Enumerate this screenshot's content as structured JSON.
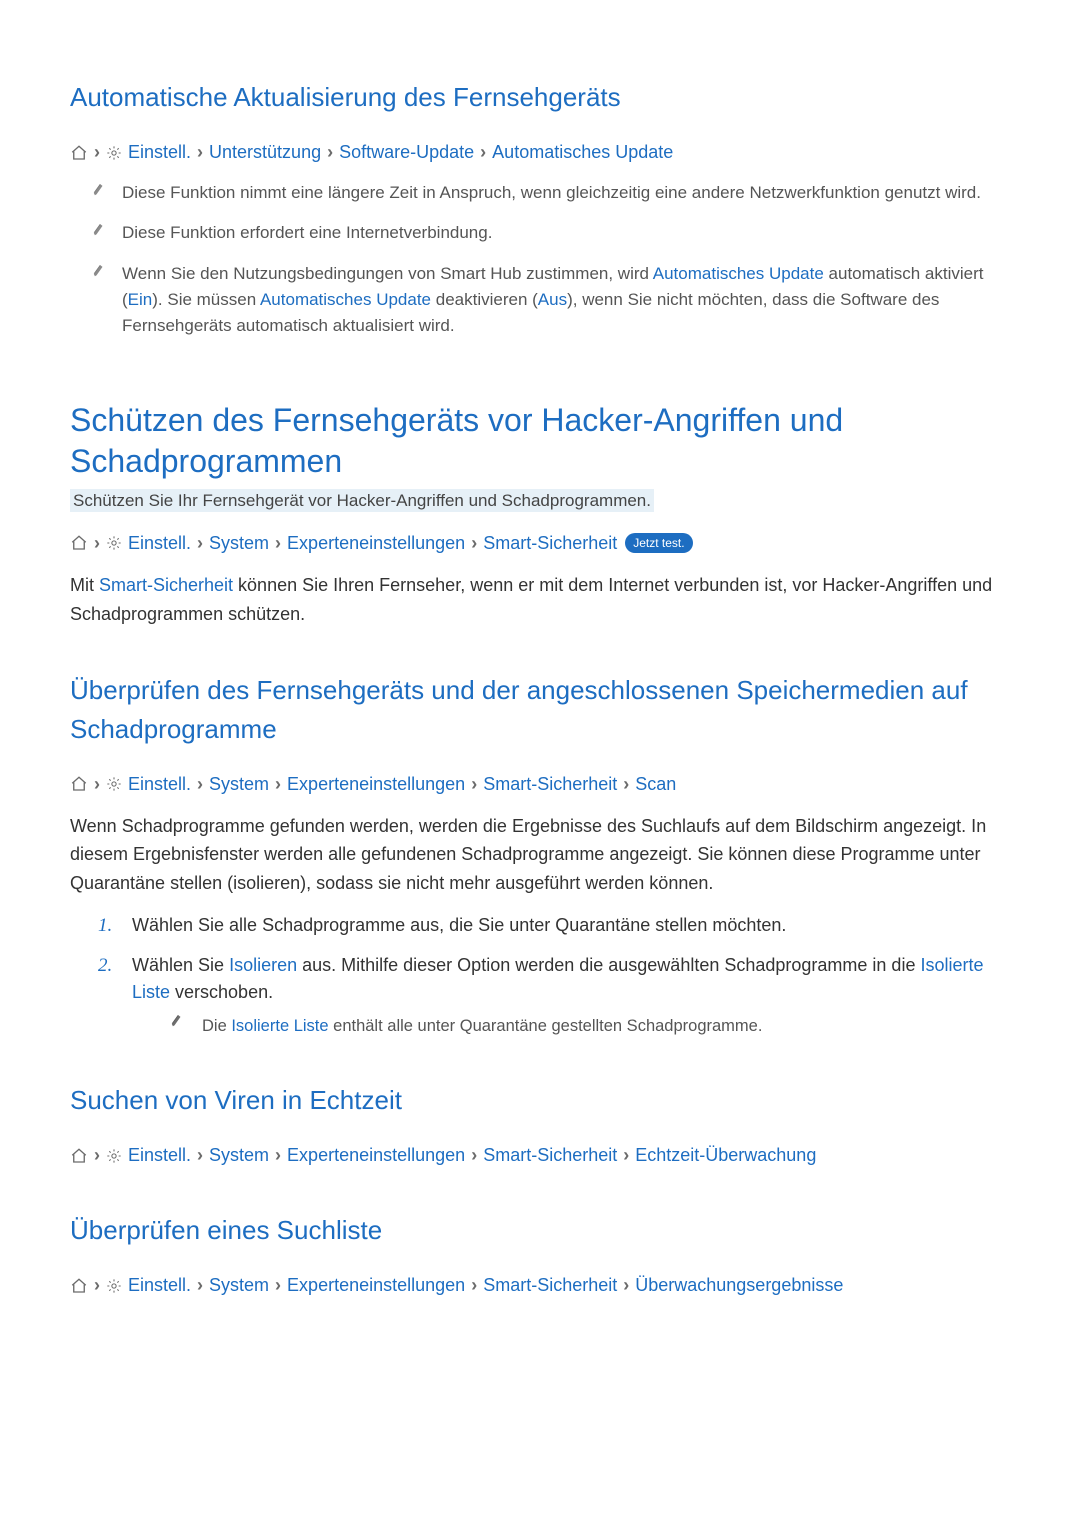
{
  "sections": {
    "auto_update": {
      "title": "Automatische Aktualisierung des Fernsehgeräts",
      "bc": {
        "settings": "Einstell.",
        "support": "Unterstützung",
        "sw_update": "Software-Update",
        "auto": "Automatisches Update"
      },
      "notes": {
        "n1": "Diese Funktion nimmt eine längere Zeit in Anspruch, wenn gleichzeitig eine andere Netzwerkfunktion genutzt wird.",
        "n2": "Diese Funktion erfordert eine Internetverbindung.",
        "n3a": "Wenn Sie den Nutzungsbedingungen von Smart Hub zustimmen, wird ",
        "n3_link1": "Automatisches Update",
        "n3b": " automatisch aktiviert (",
        "n3_on": "Ein",
        "n3c": "). Sie müssen ",
        "n3_link2": "Automatisches Update",
        "n3d": " deaktivieren (",
        "n3_off": "Aus",
        "n3e": "), wenn Sie nicht möchten, dass die Software des Fernsehgeräts automatisch aktualisiert wird."
      }
    },
    "protect": {
      "title": "Schützen des Fernsehgeräts vor Hacker-Angriffen und Schadprogrammen",
      "subtitle": "Schützen Sie Ihr Fernsehgerät vor Hacker-Angriffen und Schadprogrammen.",
      "bc": {
        "settings": "Einstell.",
        "system": "System",
        "expert": "Experteneinstellungen",
        "smart_sec": "Smart-Sicherheit",
        "try": "Jetzt test."
      },
      "body_a": "Mit ",
      "body_link": "Smart-Sicherheit",
      "body_b": " können Sie Ihren Fernseher, wenn er mit dem Internet verbunden ist, vor Hacker-Angriffen und Schadprogrammen schützen."
    },
    "scan": {
      "title": "Überprüfen des Fernsehgeräts und der angeschlossenen Speichermedien auf Schadprogramme",
      "bc": {
        "settings": "Einstell.",
        "system": "System",
        "expert": "Experteneinstellungen",
        "smart_sec": "Smart-Sicherheit",
        "scan": "Scan"
      },
      "body": "Wenn Schadprogramme gefunden werden, werden die Ergebnisse des Suchlaufs auf dem Bildschirm angezeigt. In diesem Ergebnisfenster werden alle gefundenen Schadprogramme angezeigt. Sie können diese Programme unter Quarantäne stellen (isolieren), sodass sie nicht mehr ausgeführt werden können.",
      "step1": "Wählen Sie alle Schadprogramme aus, die Sie unter Quarantäne stellen möchten.",
      "step2a": "Wählen Sie ",
      "step2_link1": "Isolieren",
      "step2b": " aus. Mithilfe dieser Option werden die ausgewählten Schadprogramme in die ",
      "step2_link2": "Isolierte Liste",
      "step2c": " verschoben.",
      "sub_a": "Die ",
      "sub_link": "Isolierte Liste",
      "sub_b": " enthält alle unter Quarantäne gestellten Schadprogramme.",
      "num1": "1.",
      "num2": "2."
    },
    "realtime": {
      "title": "Suchen von Viren in Echtzeit",
      "bc": {
        "settings": "Einstell.",
        "system": "System",
        "expert": "Experteneinstellungen",
        "smart_sec": "Smart-Sicherheit",
        "rt": "Echtzeit-Überwachung"
      }
    },
    "results": {
      "title": "Überprüfen eines Suchliste",
      "bc": {
        "settings": "Einstell.",
        "system": "System",
        "expert": "Experteneinstellungen",
        "smart_sec": "Smart-Sicherheit",
        "res": "Überwachungsergebnisse"
      }
    }
  }
}
